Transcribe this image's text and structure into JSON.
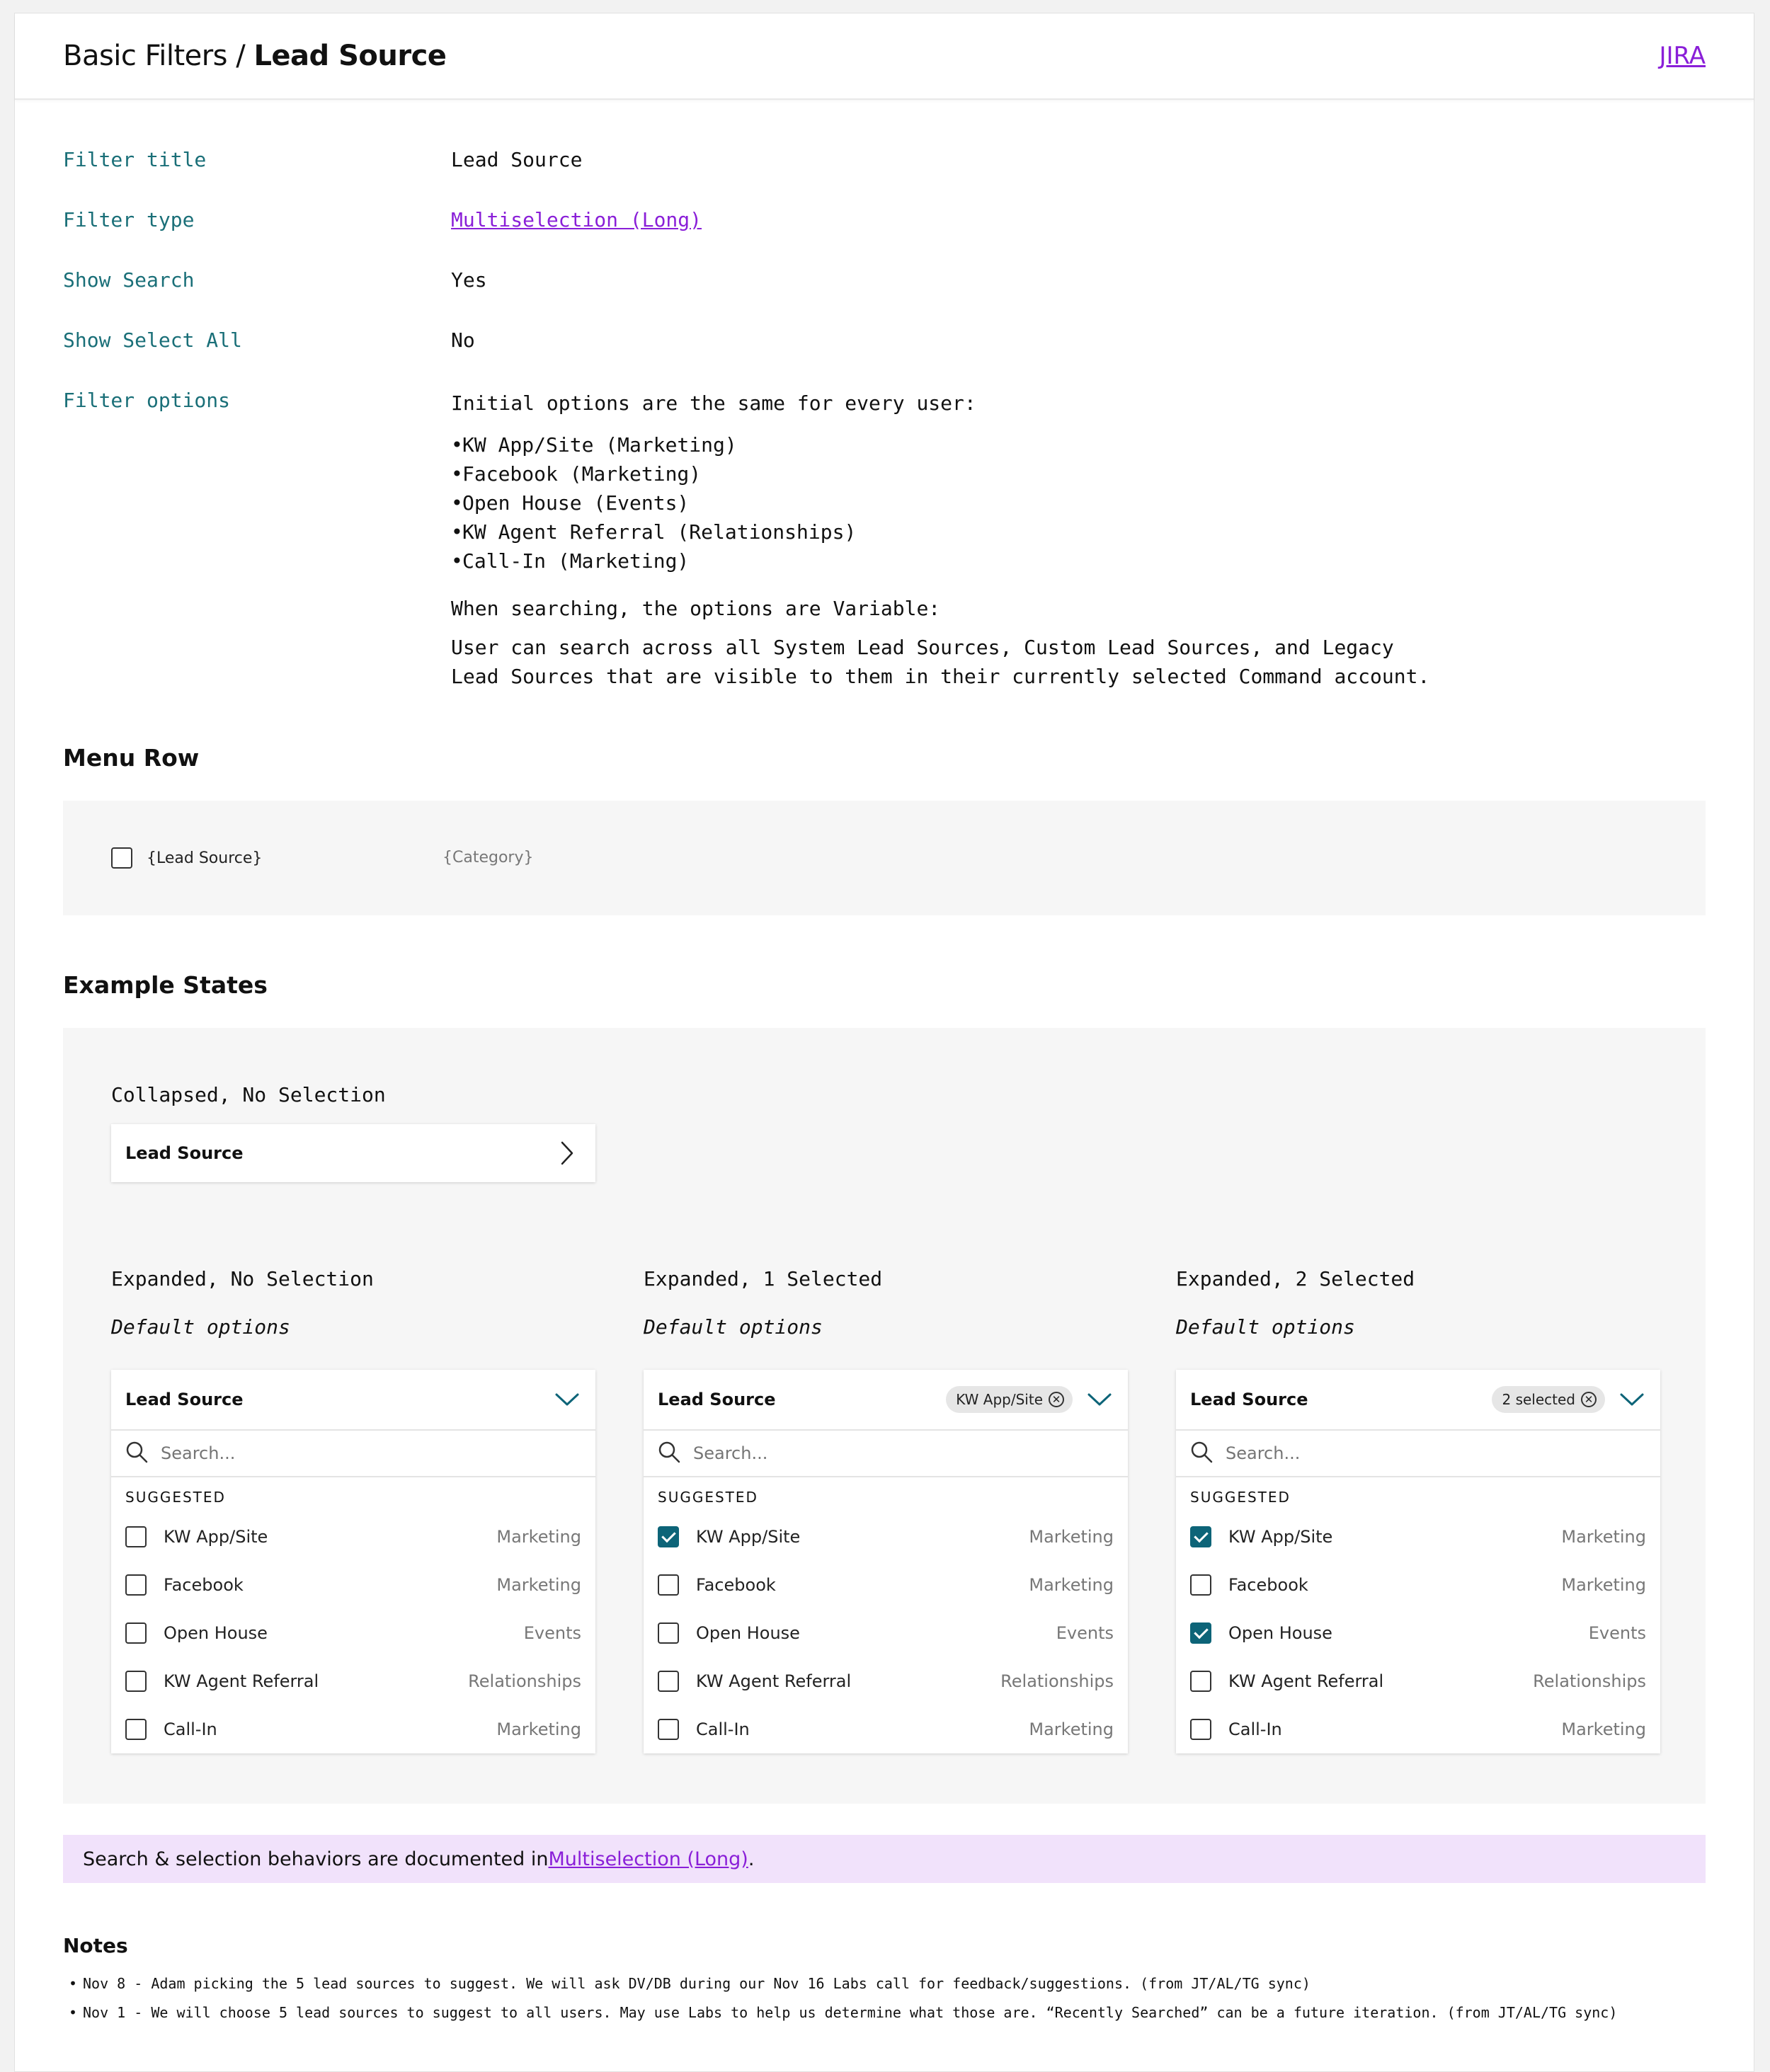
{
  "header": {
    "breadcrumb_parent": "Basic Filters /",
    "breadcrumb_current": "Lead Source",
    "jira_link": "JIRA"
  },
  "properties": {
    "filter_title_label": "Filter title",
    "filter_title_value": "Lead Source",
    "filter_type_label": "Filter type",
    "filter_type_value": "Multiselection (Long)",
    "show_search_label": "Show Search",
    "show_search_value": "Yes",
    "show_select_all_label": "Show Select All",
    "show_select_all_value": "No",
    "filter_options_label": "Filter options",
    "options_intro": "Initial options are the same for every user:",
    "options_list": [
      "KW App/Site (Marketing)",
      "Facebook (Marketing)",
      "Open House (Events)",
      "KW Agent Referral (Relationships)",
      "Call-In (Marketing)"
    ],
    "searching_text": "When searching, the options are Variable:",
    "search_desc_line1": "User can search across all System Lead Sources, Custom Lead Sources, and Legacy",
    "search_desc_line2": "Lead Sources that are visible to them in their currently selected Command account."
  },
  "menu_row": {
    "title": "Menu Row",
    "lead_source_placeholder": "{Lead Source}",
    "category_placeholder": "{Category}"
  },
  "example_states": {
    "title": "Example States",
    "collapsed_title": "Collapsed, No Selection",
    "collapsed_label": "Lead Source",
    "default_options": "Default options",
    "search_placeholder": "Search...",
    "suggested_label": "SUGGESTED",
    "expanded": [
      {
        "title": "Expanded, No Selection",
        "label": "Lead Source",
        "chip": ""
      },
      {
        "title": "Expanded, 1 Selected",
        "label": "Lead Source",
        "chip": "KW App/Site"
      },
      {
        "title": "Expanded, 2 Selected",
        "label": "Lead Source",
        "chip": "2 selected"
      }
    ],
    "options": [
      {
        "name": "KW App/Site",
        "category": "Marketing"
      },
      {
        "name": "Facebook",
        "category": "Marketing"
      },
      {
        "name": "Open House",
        "category": "Events"
      },
      {
        "name": "KW Agent Referral",
        "category": "Relationships"
      },
      {
        "name": "Call-In",
        "category": "Marketing"
      }
    ],
    "checked": [
      [
        false,
        false,
        false,
        false,
        false
      ],
      [
        true,
        false,
        false,
        false,
        false
      ],
      [
        true,
        false,
        true,
        false,
        false
      ]
    ]
  },
  "notice": {
    "prefix": "Search & selection behaviors are documented in ",
    "link": "Multiselection (Long)",
    "suffix": "."
  },
  "notes": {
    "title": "Notes",
    "items": [
      "Nov 8 - Adam picking the 5 lead sources to suggest. We will ask DV/DB during our Nov 16 Labs call for feedback/suggestions. (from JT/AL/TG sync)",
      "Nov 1 - We will choose 5 lead sources to suggest to all users. May use Labs to help us determine what those are. “Recently Searched” can be a future iteration. (from JT/AL/TG sync)"
    ]
  },
  "colors": {
    "accent_teal": "#1a6f78",
    "link_purple": "#8a1fd8",
    "checkbox_checked": "#0d6478",
    "notice_bg": "#f1e2fb"
  },
  "icons": [
    "chevron-right-icon",
    "chevron-down-icon",
    "search-icon",
    "clear-chip-icon",
    "checkbox-icon"
  ]
}
